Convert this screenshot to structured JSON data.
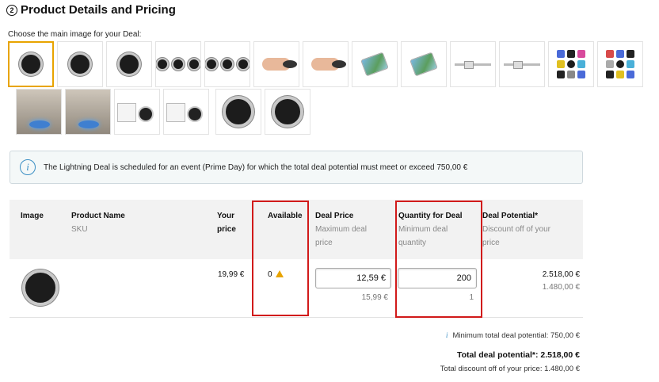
{
  "section": {
    "step_number": "2",
    "title": "Product Details and Pricing",
    "choose_image_label": "Choose the main image for your Deal:"
  },
  "notice": {
    "text": "The Lightning Deal is scheduled for an event (Prime Day) for which the total deal potential must meet or exceed 750,00 €"
  },
  "table": {
    "headers": {
      "image": "Image",
      "product_name": "Product Name",
      "sku": "SKU",
      "your_price_1": "Your",
      "your_price_2": "price",
      "available": "Available",
      "deal_price": "Deal Price",
      "deal_price_sub_1": "Maximum deal",
      "deal_price_sub_2": "price",
      "quantity": "Quantity for Deal",
      "quantity_sub_1": "Minimum deal",
      "quantity_sub_2": "quantity",
      "deal_potential": "Deal Potential*",
      "deal_potential_sub_1": "Discount off of your",
      "deal_potential_sub_2": "price"
    },
    "row": {
      "your_price": "19,99 €",
      "available": "0",
      "deal_price_value": "12,59 €",
      "deal_price_max": "15,99 €",
      "quantity_value": "200",
      "quantity_min": "1",
      "deal_potential": "2.518,00 €",
      "discount": "1.480,00 €"
    }
  },
  "summary": {
    "min_potential": "Minimum total deal potential: 750,00 €",
    "total_potential": "Total deal potential*: 2.518,00 €",
    "total_discount": "Total discount off of your price: 1.480,00 €"
  },
  "colors": {
    "highlight_red": "#d11a1a",
    "warning_orange": "#e8a400",
    "info_blue": "#3b8fc4"
  },
  "icons": {
    "info": "info-icon",
    "warning": "warning-icon"
  }
}
